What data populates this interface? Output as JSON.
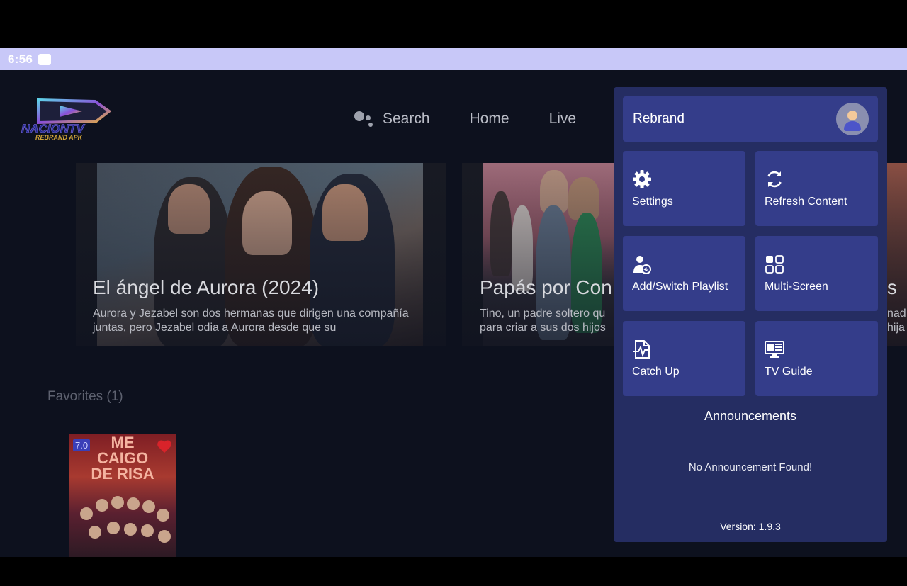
{
  "status_bar": {
    "time": "6:56"
  },
  "logo": {
    "text": "NACIONTV",
    "subtext": "REBRAND APK"
  },
  "nav": {
    "search_label": "Search",
    "home_label": "Home",
    "live_label": "Live"
  },
  "hero": [
    {
      "title": "El ángel de Aurora (2024)",
      "description": "Aurora y Jezabel son dos hermanas que dirigen una compañía juntas, pero Jezabel odia a Aurora desde que su"
    },
    {
      "title": "Papás por Con",
      "description_line1": "Tino, un padre soltero qu",
      "description_line2": "para criar a sus dos hijos"
    },
    {
      "title": "s",
      "description_line1": "nad",
      "description_line2": "hija"
    }
  ],
  "favorites": {
    "title": "Favorites (1)",
    "items": [
      {
        "poster_text": "ME CAIGO DE RISA",
        "rating": "7.0",
        "favorite": true
      }
    ]
  },
  "menu": {
    "profile_name": "Rebrand",
    "tiles": [
      {
        "label": "Settings",
        "icon": "gear-icon"
      },
      {
        "label": "Refresh Content",
        "icon": "refresh-icon"
      },
      {
        "label": "Add/Switch Playlist",
        "icon": "user-switch-icon"
      },
      {
        "label": "Multi-Screen",
        "icon": "multi-screen-icon"
      },
      {
        "label": "Catch Up",
        "icon": "catch-up-icon"
      },
      {
        "label": "TV Guide",
        "icon": "tv-guide-icon"
      }
    ],
    "announcements_title": "Announcements",
    "announcements_empty": "No Announcement Found!",
    "version": "Version: 1.9.3"
  }
}
